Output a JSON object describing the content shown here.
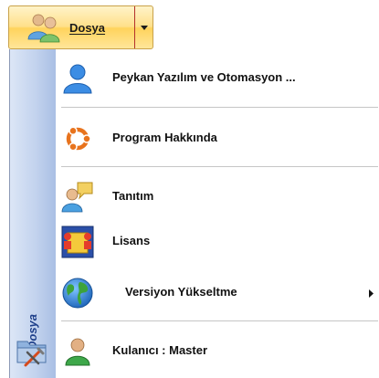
{
  "button": {
    "label": "Dosya",
    "icon": "users-icon",
    "dropdown_icon": "chevron-down-icon",
    "colors": {
      "fill": "#ffd35c",
      "border": "#c9a24a",
      "divider": "#b4302b"
    }
  },
  "menu": {
    "side_label": "Dosya",
    "side_icon": "folder-tools-icon",
    "items": [
      {
        "label": "Peykan Yazılım ve Otomasyon ...",
        "icon": "user-icon"
      },
      {
        "label": "Program Hakkında",
        "icon": "ubuntu-ring-icon"
      },
      {
        "label": "Tanıtım",
        "icon": "chat-user-icon"
      },
      {
        "label": "Lisans",
        "icon": "license-icon"
      },
      {
        "label": "Versiyon Yükseltme",
        "icon": "globe-icon",
        "has_submenu": true
      },
      {
        "label": "Kulanıcı : Master",
        "icon": "user-green-icon"
      }
    ],
    "colors": {
      "strip": "#c3d3ee",
      "strip_text": "#1e3f8a",
      "separator": "#c6c6c6"
    }
  }
}
